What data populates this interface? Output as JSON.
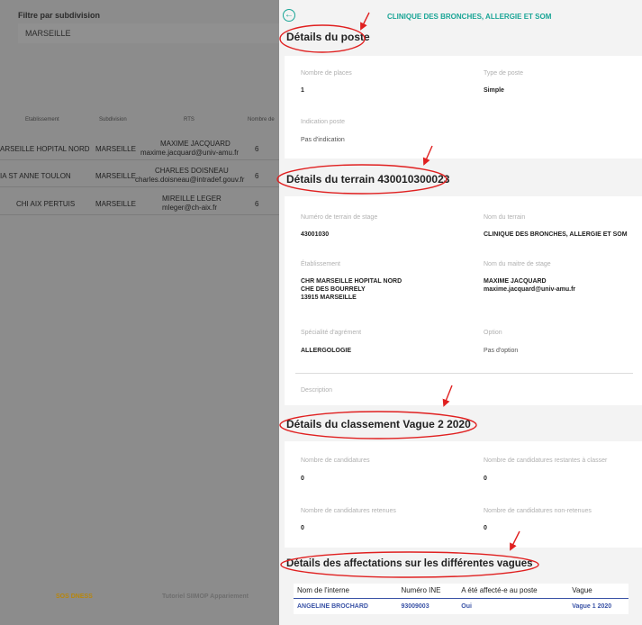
{
  "filter": {
    "label": "Filtre par subdivision",
    "value": "MARSEILLE"
  },
  "left_table": {
    "headers": [
      "Etablissement",
      "Subdivision",
      "RTS",
      "Nombre de"
    ],
    "rows": [
      {
        "etab": "ARSEILLE HOPITAL NORD",
        "subdivision": "MARSEILLE",
        "name": "MAXIME JACQUARD",
        "email": "maxime.jacquard@univ-amu.fr",
        "places": "6"
      },
      {
        "etab": "IA ST ANNE TOULON",
        "subdivision": "MARSEILLE",
        "name": "CHARLES DOISNEAU",
        "email": "charles.doisneau@intradef.gouv.fr",
        "places": "6"
      },
      {
        "etab": "CHI AIX PERTUIS",
        "subdivision": "MARSEILLE",
        "name": "MIREILLE LEGER",
        "email": "mleger@ch-aix.fr",
        "places": "6"
      }
    ]
  },
  "left_footer": {
    "link1": "SOS DNESS",
    "link2": "Tutoriel SIIMOP Appariement"
  },
  "drawer": {
    "title": "CLINIQUE DES BRONCHES, ALLERGIE ET SOM",
    "poste": {
      "section_title": "Détails du poste",
      "nb_places_label": "Nombre de places",
      "nb_places": "1",
      "type_label": "Type de poste",
      "type": "Simple",
      "indication_label": "Indication poste",
      "indication": "Pas d'indication"
    },
    "terrain": {
      "section_title": "Détails du terrain 430010300023",
      "numero_label": "Numéro de terrain de stage",
      "numero": "43001030",
      "nom_label": "Nom du terrain",
      "nom": "CLINIQUE DES BRONCHES, ALLERGIE ET SOM",
      "etab_label": "Établissement",
      "etab_line1": "CHR MARSEILLE HOPITAL NORD",
      "etab_line2": "CHE DES BOURRELY",
      "etab_line3": "13915 MARSEILLE",
      "maitre_label": "Nom du maitre de stage",
      "maitre_name": "MAXIME JACQUARD",
      "maitre_email": "maxime.jacquard@univ-amu.fr",
      "specialite_label": "Spécialité d'agrément",
      "specialite": "ALLERGOLOGIE",
      "option_label": "Option",
      "option": "Pas d'option",
      "description_label": "Description"
    },
    "classement": {
      "section_title": "Détails du classement Vague 2 2020",
      "nb_cand_label": "Nombre de candidatures",
      "nb_cand": "0",
      "restantes_label": "Nombre de candidatures restantes à classer",
      "restantes": "0",
      "retenues_label": "Nombre de candidatures retenues",
      "retenues": "0",
      "non_retenues_label": "Nombre de candidatures non-retenues",
      "non_retenues": "0"
    },
    "affectations": {
      "section_title": "Détails des affectations sur les différentes vagues",
      "headers": [
        "Nom de l'interne",
        "Numéro INE",
        "A été affecté-e au poste",
        "Vague"
      ],
      "rows": [
        {
          "nom": "ANGELINE BROCHARD",
          "ine": "93009003",
          "affecte": "Oui",
          "vague": "Vague 1 2020"
        }
      ]
    }
  },
  "colors": {
    "accent": "#1aa596",
    "annotation": "#e02020",
    "link_blue": "#3a53a6",
    "overlay": "#8c8c8c"
  }
}
